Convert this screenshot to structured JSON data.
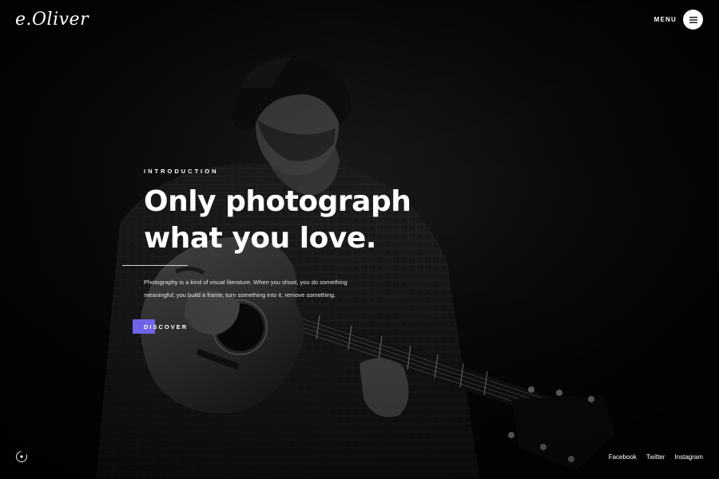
{
  "header": {
    "logo_text": "e.Oliver",
    "menu_label": "MENU",
    "menu_icon": "hamburger-icon"
  },
  "hero": {
    "background_image": "black-and-white photo of a man playing an acoustic guitar",
    "eyebrow": "INTRODUCTION",
    "headline_line1": "Only photograph",
    "headline_line2": "what you love.",
    "description_line1": "Photography is a kind of visual literature. When you shoot, you do something",
    "description_line2": "meaningful; you build a frame, turn something into it, remove something.",
    "cta_label": "DISCOVER",
    "accent_color": "#6f63e8"
  },
  "footer": {
    "scroll_icon": "scroll-down-icon",
    "social": [
      {
        "label": "Facebook"
      },
      {
        "label": "Twitter"
      },
      {
        "label": "Instagram"
      }
    ]
  }
}
